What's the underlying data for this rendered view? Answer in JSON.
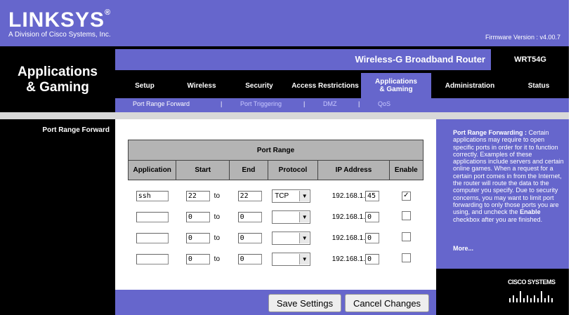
{
  "brand": {
    "logo": "LINKSYS",
    "registered": "®",
    "subtitle": "A Division of Cisco Systems, Inc.",
    "firmware": "Firmware Version : v4.00.7"
  },
  "section_title_line1": "Applications",
  "section_title_line2": "& Gaming",
  "product": {
    "name": "Wireless-G Broadband Router",
    "model": "WRT54G"
  },
  "tabs": [
    {
      "label": "Setup"
    },
    {
      "label": "Wireless"
    },
    {
      "label": "Security"
    },
    {
      "label": "Access Restrictions"
    },
    {
      "label_line1": "Applications",
      "label_line2": "& Gaming"
    },
    {
      "label": "Administration"
    },
    {
      "label": "Status"
    }
  ],
  "subtabs": [
    {
      "label": "Port Range Forward"
    },
    {
      "label": "Port Triggering"
    },
    {
      "label": "DMZ"
    },
    {
      "label": "QoS"
    }
  ],
  "separator": "|",
  "left_label": "Port Range Forward",
  "table": {
    "title": "Port Range",
    "columns": [
      "Application",
      "Start",
      "End",
      "Protocol",
      "IP Address",
      "Enable"
    ],
    "to_label": "to",
    "ip_prefix": "192.168.1.",
    "rows": [
      {
        "application": "ssh",
        "start": "22",
        "end": "22",
        "protocol": "TCP",
        "ip_last": "45",
        "enabled": "✓"
      },
      {
        "application": "",
        "start": "0",
        "end": "0",
        "protocol": "",
        "ip_last": "0",
        "enabled": ""
      },
      {
        "application": "",
        "start": "0",
        "end": "0",
        "protocol": "",
        "ip_last": "0",
        "enabled": ""
      },
      {
        "application": "",
        "start": "0",
        "end": "0",
        "protocol": "",
        "ip_last": "0",
        "enabled": ""
      }
    ]
  },
  "help": {
    "heading": "Port Range Forwarding :",
    "body1": " Certain applications may require to open specific ports in order for it to function correctly. Examples of these applications include servers and certain online games. When a request for a certain port comes in from the Internet, the router will route the data to the computer you specify. Due to security concerns, you may want to limit port forwarding to only those ports you are using, and uncheck the ",
    "bold_word": "Enable",
    "body2": " checkbox after you are finished.",
    "more": "More..."
  },
  "cisco": {
    "text": "CISCO SYSTEMS"
  },
  "buttons": {
    "save": "Save Settings",
    "cancel": "Cancel Changes"
  },
  "colors": {
    "accent": "#6666cc",
    "black": "#000000",
    "table_header": "#b4b4b4"
  }
}
